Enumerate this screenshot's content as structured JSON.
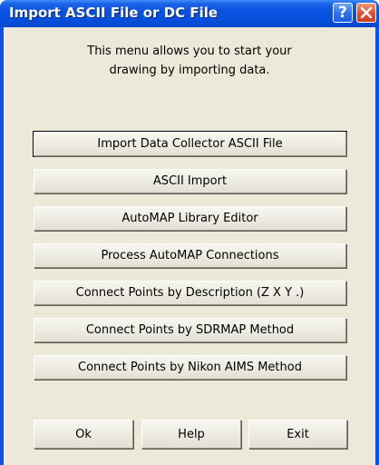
{
  "window": {
    "title": "Import ASCII File or DC File",
    "help_glyph": "?",
    "close_glyph": "✕"
  },
  "intro": {
    "line1": "This menu allows you to start your",
    "line2": "drawing by importing data."
  },
  "menu_buttons": [
    "Import Data Collector ASCII File",
    "ASCII Import",
    "AutoMAP Library Editor",
    "Process AutoMAP Connections",
    "Connect Points by Description (Z X Y .)",
    "Connect Points by SDRMAP Method",
    "Connect Points by Nikon AIMS Method"
  ],
  "dialog_buttons": {
    "ok": "Ok",
    "help": "Help",
    "exit": "Exit"
  },
  "colors": {
    "titlebar": "#0a53e2",
    "dialog_face": "#ece9d8",
    "close_button": "#e05330"
  }
}
